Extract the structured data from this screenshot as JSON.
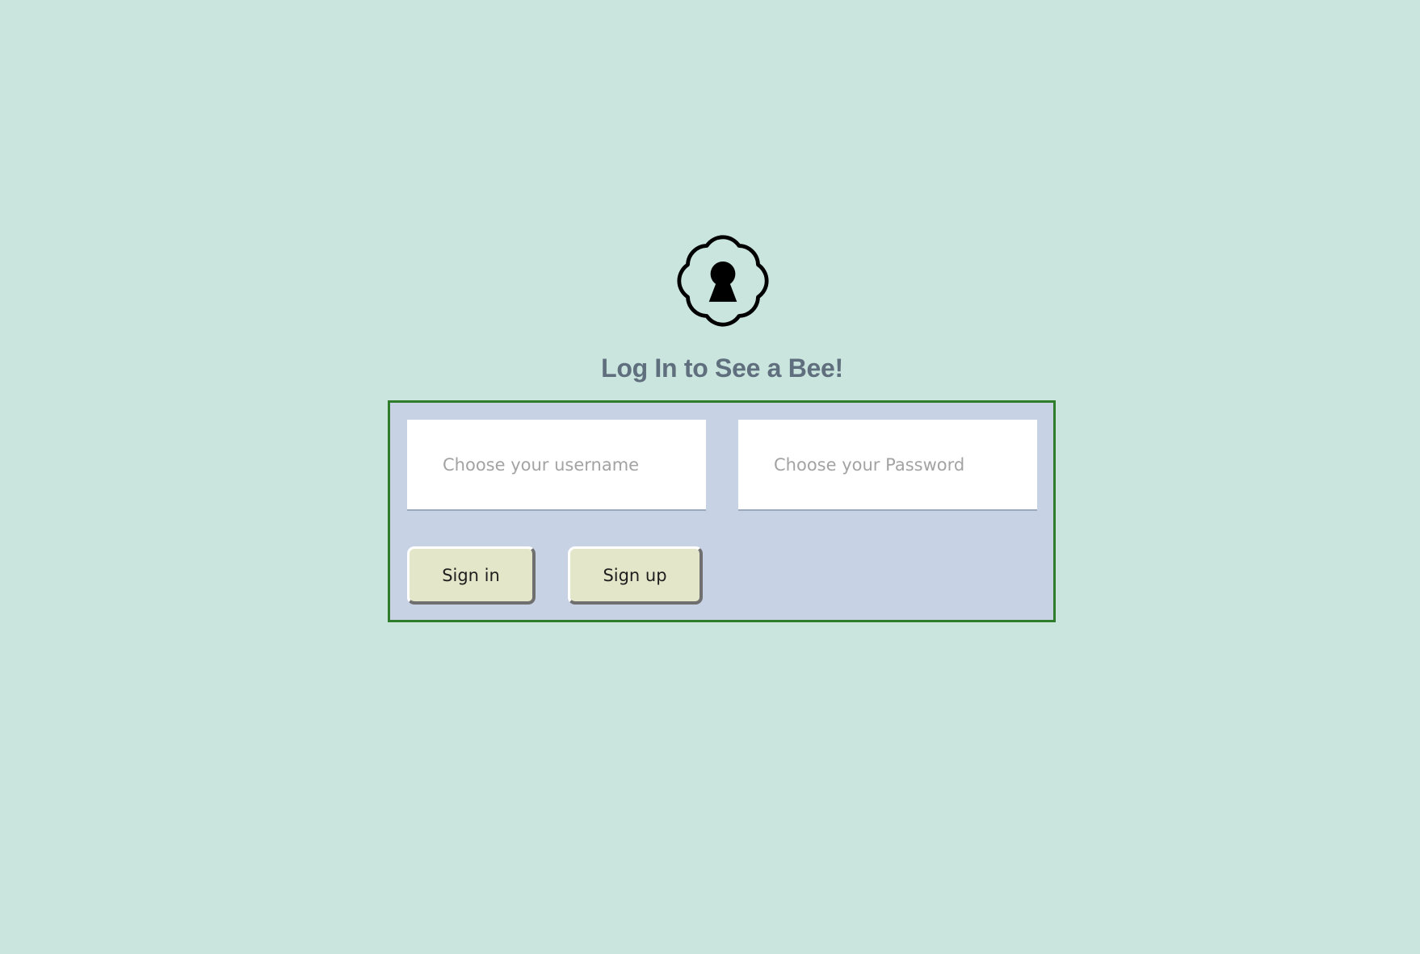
{
  "page": {
    "title": "Log In to See a Bee!",
    "background_color": "#cae4de"
  },
  "logo": {
    "icon": "keyhole-badge-icon"
  },
  "login_form": {
    "username_placeholder": "Choose your username",
    "password_placeholder": "Choose your Password",
    "sign_in_label": "Sign in",
    "sign_up_label": "Sign up",
    "panel_color": "#c8d2e5",
    "panel_border_color": "#2f7d2b",
    "button_color": "#e4e6c9"
  }
}
